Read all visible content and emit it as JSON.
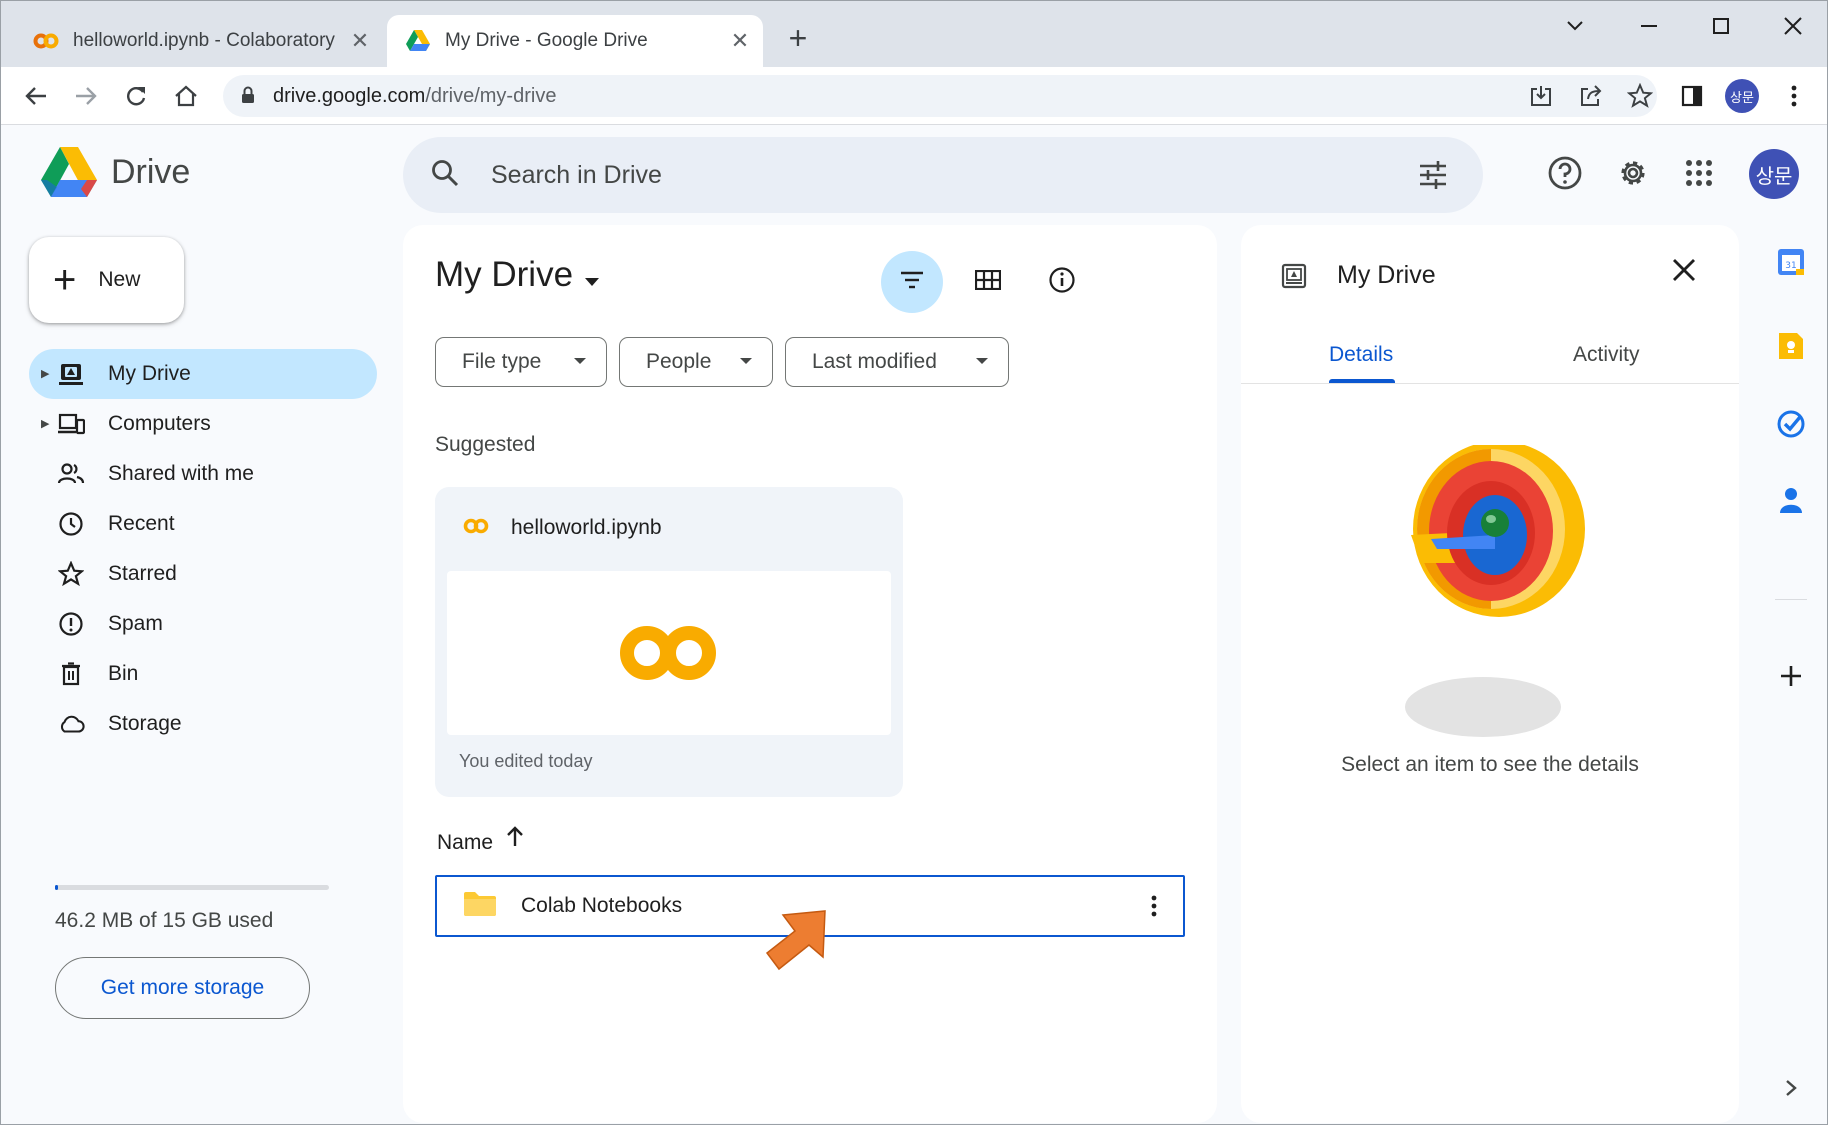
{
  "browser": {
    "tabs": [
      {
        "title": "helloworld.ipynb - Colaboratory",
        "icon": "colab-icon",
        "active": false
      },
      {
        "title": "My Drive - Google Drive",
        "icon": "drive-icon",
        "active": true
      }
    ],
    "url_host": "drive.google.com",
    "url_path": "/drive/my-drive",
    "profile_initials": "상문"
  },
  "drive": {
    "logo_text": "Drive",
    "search_placeholder": "Search in Drive",
    "avatar_initials": "상문",
    "new_button": "New",
    "nav": [
      {
        "label": "My Drive",
        "icon": "my-drive-icon",
        "active": true,
        "expandable": true
      },
      {
        "label": "Computers",
        "icon": "computers-icon",
        "active": false,
        "expandable": true
      },
      {
        "label": "Shared with me",
        "icon": "shared-icon",
        "active": false,
        "expandable": false
      },
      {
        "label": "Recent",
        "icon": "clock-icon",
        "active": false,
        "expandable": false
      },
      {
        "label": "Starred",
        "icon": "star-icon",
        "active": false,
        "expandable": false
      },
      {
        "label": "Spam",
        "icon": "spam-icon",
        "active": false,
        "expandable": false
      },
      {
        "label": "Bin",
        "icon": "trash-icon",
        "active": false,
        "expandable": false
      },
      {
        "label": "Storage",
        "icon": "cloud-icon",
        "active": false,
        "expandable": false
      }
    ],
    "storage_used_fraction": 0.003,
    "storage_text": "46.2 MB of 15 GB used",
    "get_more_storage": "Get more storage",
    "main": {
      "title": "My Drive",
      "filters": [
        "File type",
        "People",
        "Last modified"
      ],
      "suggested_label": "Suggested",
      "suggested_file": {
        "name": "helloworld.ipynb",
        "subtitle": "You edited today",
        "thumb_text": "CO"
      },
      "sort_column": "Name",
      "files": [
        {
          "name": "Colab Notebooks",
          "type": "folder"
        }
      ]
    },
    "details": {
      "title": "My Drive",
      "tabs": [
        "Details",
        "Activity"
      ],
      "active_tab": "Details",
      "hint": "Select an item to see the details"
    },
    "side_panel_apps": [
      "calendar-icon",
      "keep-icon",
      "tasks-icon",
      "contacts-icon"
    ]
  },
  "colors": {
    "accent": "#0b57d0",
    "nav_active": "#c2e7ff",
    "colab_orange": "#f9ab00",
    "pointer_arrow": "#ed7d31"
  }
}
